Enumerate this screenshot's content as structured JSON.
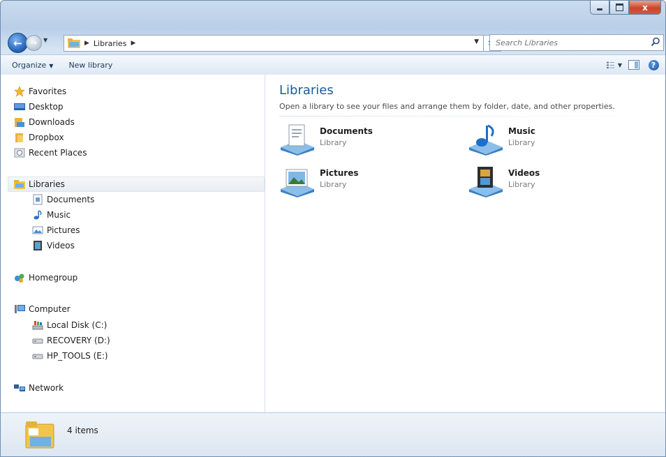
{
  "window": {
    "title": "Libraries",
    "caption_buttons": {
      "minimize_icon": "minimize-icon",
      "maximize_icon": "maximize-icon",
      "close_label": "x"
    }
  },
  "address": {
    "breadcrumbs": [
      "Libraries"
    ],
    "search_placeholder": "Search Libraries"
  },
  "toolbar": {
    "organize_label": "Organize",
    "new_library_label": "New library"
  },
  "nav": {
    "favorites": {
      "label": "Favorites",
      "items": [
        "Desktop",
        "Downloads",
        "Dropbox",
        "Recent Places"
      ]
    },
    "libraries": {
      "label": "Libraries",
      "items": [
        "Documents",
        "Music",
        "Pictures",
        "Videos"
      ]
    },
    "homegroup": {
      "label": "Homegroup"
    },
    "computer": {
      "label": "Computer",
      "items": [
        "Local Disk (C:)",
        "RECOVERY (D:)",
        "HP_TOOLS (E:)"
      ]
    },
    "network": {
      "label": "Network"
    }
  },
  "content": {
    "heading": "Libraries",
    "description": "Open a library to see your files and arrange them by folder, date, and other properties.",
    "libraries": [
      {
        "name": "Documents",
        "type": "Library",
        "icon": "documents-library-icon"
      },
      {
        "name": "Music",
        "type": "Library",
        "icon": "music-library-icon"
      },
      {
        "name": "Pictures",
        "type": "Library",
        "icon": "pictures-library-icon"
      },
      {
        "name": "Videos",
        "type": "Library",
        "icon": "videos-library-icon"
      }
    ]
  },
  "details": {
    "count_text": "4 items"
  },
  "colors": {
    "accent": "#1e5a96",
    "frame": "#b9cfe7",
    "close": "#c7462d"
  }
}
